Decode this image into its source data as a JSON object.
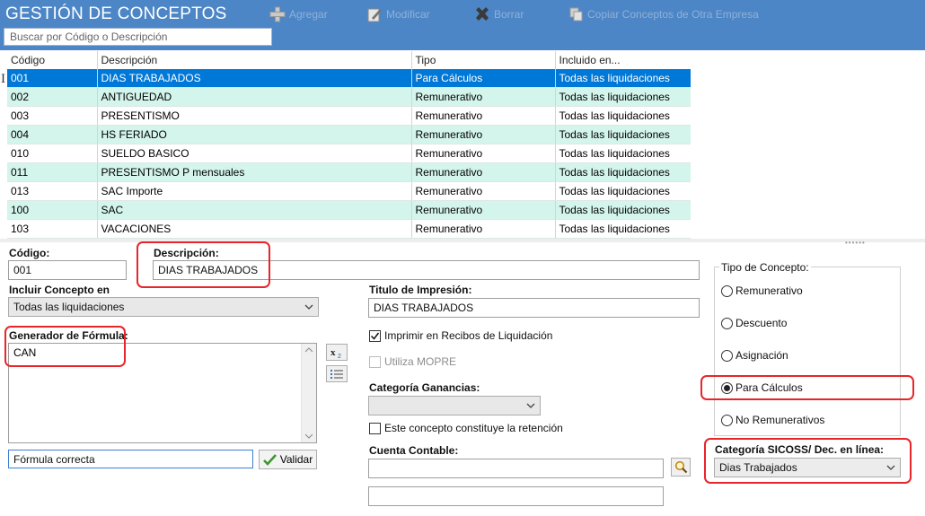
{
  "header": {
    "title": "GESTIÓN DE CONCEPTOS",
    "toolbar": {
      "add": "Agregar",
      "modify": "Modificar",
      "delete": "Borrar",
      "copy": "Copiar Conceptos de Otra Empresa"
    },
    "search_placeholder": "Buscar por Código o Descripción"
  },
  "grid": {
    "columns": [
      "Código",
      "Descripción",
      "Tipo",
      "Incluido en..."
    ],
    "rows": [
      [
        "001",
        "DIAS TRABAJADOS",
        "Para Cálculos",
        "Todas las liquidaciones"
      ],
      [
        "002",
        "ANTIGUEDAD",
        "Remunerativo",
        "Todas las liquidaciones"
      ],
      [
        "003",
        "PRESENTISMO",
        "Remunerativo",
        "Todas las liquidaciones"
      ],
      [
        "004",
        "HS FERIADO",
        "Remunerativo",
        "Todas las liquidaciones"
      ],
      [
        "010",
        "SUELDO BASICO",
        "Remunerativo",
        "Todas las liquidaciones"
      ],
      [
        "011",
        "PRESENTISMO P mensuales",
        "Remunerativo",
        "Todas las liquidaciones"
      ],
      [
        "013",
        "SAC Importe",
        "Remunerativo",
        "Todas las liquidaciones"
      ],
      [
        "100",
        "SAC",
        "Remunerativo",
        "Todas las liquidaciones"
      ],
      [
        "103",
        "VACACIONES",
        "Remunerativo",
        "Todas las liquidaciones"
      ]
    ]
  },
  "form": {
    "codigo_label": "Código:",
    "codigo_value": "001",
    "descripcion_label": "Descripción:",
    "descripcion_value": "DIAS TRABAJADOS",
    "incluir_label": "Incluir Concepto en",
    "incluir_value": "Todas las liquidaciones",
    "titulo_label": "Titulo de Impresión:",
    "titulo_value": "DIAS TRABAJADOS",
    "formula_label": "Generador de Fórmula:",
    "formula_value": "CAN",
    "imprimir_label": "Imprimir en Recibos de Liquidación",
    "mopre_label": "Utiliza MOPRE",
    "ganancias_label": "Categoría Ganancias:",
    "retencion_label": "Este concepto constituye la retención",
    "status_value": "Fórmula correcta",
    "validar_label": "Validar",
    "cuenta_label": "Cuenta Contable:",
    "tipo_label": "Tipo de Concepto:",
    "tipo_options": [
      "Remunerativo",
      "Descuento",
      "Asignación",
      "Para Cálculos",
      "No Remunerativos"
    ],
    "sicoss_label": "Categoría SICOSS/ Dec. en línea:",
    "sicoss_value": "Dias Trabajados"
  },
  "colors": {
    "header": "#4d86c6",
    "selected_row": "#0078d7",
    "alt_row": "#d4f5ec",
    "highlight": "#e8252b"
  }
}
